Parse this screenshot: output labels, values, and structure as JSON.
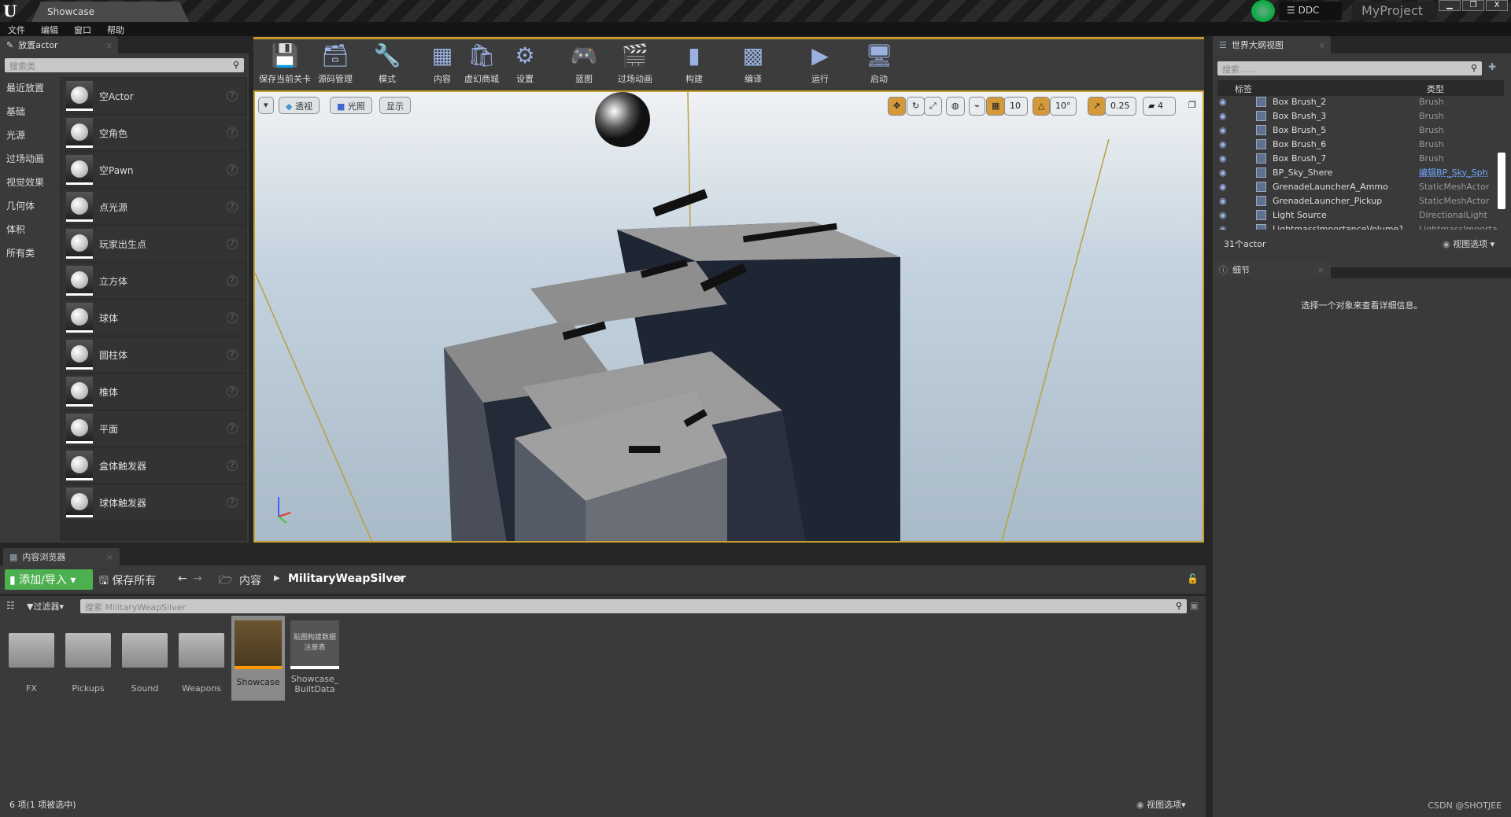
{
  "window": {
    "tab": "Showcase",
    "ddc": "DDC",
    "project": "MyProject",
    "controls": [
      "▁",
      "❐",
      "X"
    ]
  },
  "menu": [
    "文件",
    "编辑",
    "窗口",
    "帮助"
  ],
  "place_actor": {
    "tab": "放置actor",
    "search_placeholder": "搜索类",
    "categories": [
      "最近放置",
      "基础",
      "光源",
      "过场动画",
      "视觉效果",
      "几何体",
      "体积",
      "所有类"
    ],
    "selected_category": "基础",
    "items": [
      "空Actor",
      "空角色",
      "空Pawn",
      "点光源",
      "玩家出生点",
      "立方体",
      "球体",
      "圆柱体",
      "椎体",
      "平面",
      "盒体触发器",
      "球体触发器"
    ]
  },
  "toolbar": [
    {
      "label": "保存当前关卡",
      "icon": "save-icon",
      "glyph": "💾"
    },
    {
      "label": "源码管理",
      "icon": "source-control-icon",
      "glyph": "🗃"
    },
    {
      "label": "模式",
      "icon": "modes-icon",
      "glyph": "🔧"
    },
    {
      "label": "内容",
      "icon": "content-icon",
      "glyph": "▦"
    },
    {
      "label": "虚幻商城",
      "icon": "marketplace-icon",
      "glyph": "🛍"
    },
    {
      "label": "设置",
      "icon": "settings-icon",
      "glyph": "⚙"
    },
    {
      "label": "蓝图",
      "icon": "blueprint-icon",
      "glyph": "🎮"
    },
    {
      "label": "过场动画",
      "icon": "cinematics-icon",
      "glyph": "🎬"
    },
    {
      "label": "构建",
      "icon": "build-icon",
      "glyph": "▮"
    },
    {
      "label": "编译",
      "icon": "compile-icon",
      "glyph": "▩"
    },
    {
      "label": "运行",
      "icon": "play-icon",
      "glyph": "▶"
    },
    {
      "label": "启动",
      "icon": "launch-icon",
      "glyph": "🖥"
    }
  ],
  "viewport": {
    "perspective": "透视",
    "lit": "光照",
    "show": "显示",
    "grid_snap": "10",
    "rot_snap": "10°",
    "scale_snap": "0.25",
    "camera_speed": "4"
  },
  "outliner": {
    "tab": "世界大纲视图",
    "search_placeholder": "搜索......",
    "col_label": "标签",
    "col_type": "类型",
    "rows": [
      {
        "name": "Box Brush_2",
        "type": "Brush"
      },
      {
        "name": "Box Brush_3",
        "type": "Brush"
      },
      {
        "name": "Box Brush_5",
        "type": "Brush"
      },
      {
        "name": "Box Brush_6",
        "type": "Brush"
      },
      {
        "name": "Box Brush_7",
        "type": "Brush"
      },
      {
        "name": "BP_Sky_Shere",
        "type": "编辑BP_Sky_Sph"
      },
      {
        "name": "GrenadeLauncherA_Ammo",
        "type": "StaticMeshActor"
      },
      {
        "name": "GrenadeLauncher_Pickup",
        "type": "StaticMeshActor"
      },
      {
        "name": "Light Source",
        "type": "DirectionalLight"
      },
      {
        "name": "LightmassImportanceVolume1",
        "type": "LightmassImporta"
      }
    ],
    "count": "31个actor",
    "view_options": "视图选项"
  },
  "details": {
    "tab": "细节",
    "message": "选择一个对象来查看详细信息。"
  },
  "content_browser": {
    "tab": "内容浏览器",
    "add_import": "添加/导入",
    "save_all": "保存所有",
    "path": [
      "内容",
      "MilitaryWeapSilver"
    ],
    "filter": "过滤器",
    "search_placeholder": "搜索 MilitaryWeapSilver",
    "assets": [
      {
        "name": "FX",
        "kind": "folder"
      },
      {
        "name": "Pickups",
        "kind": "folder"
      },
      {
        "name": "Sound",
        "kind": "folder"
      },
      {
        "name": "Weapons",
        "kind": "folder"
      },
      {
        "name": "Showcase",
        "kind": "level",
        "selected": true
      },
      {
        "name": "Showcase_ BuiltData",
        "kind": "builtdata",
        "thumb_text": "贴图构建数据注册表"
      }
    ],
    "status": "6 项(1 项被选中)",
    "view_options": "视图选项"
  },
  "watermark": "CSDN @SHOTJEE",
  "colors": {
    "accent": "#c8a02c",
    "add_button": "#4caf50",
    "link": "#6fa8ff"
  }
}
